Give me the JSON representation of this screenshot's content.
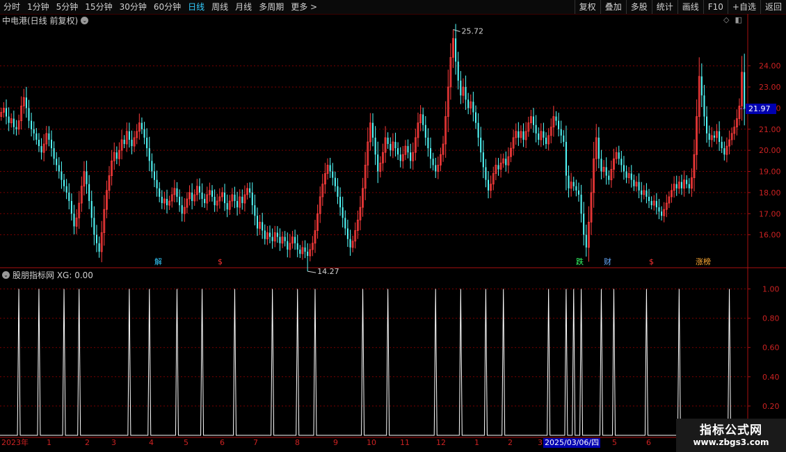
{
  "toolbar": {
    "left": [
      "分时",
      "1分钟",
      "5分钟",
      "15分钟",
      "30分钟",
      "60分钟",
      "日线",
      "周线",
      "月线",
      "多周期",
      "更多 >"
    ],
    "active_index": 6,
    "right": [
      "复权",
      "叠加",
      "多股",
      "统计",
      "画线",
      "F10",
      "+自选",
      "返回"
    ]
  },
  "main_title": "中电港(日线 前复权)",
  "indicator_title": "股朋指标网 XG: 0.00",
  "current_price": "21.97",
  "price_axis": [
    "24.00",
    "23.00",
    "22.00",
    "21.00",
    "20.00",
    "19.00",
    "18.00",
    "17.00",
    "16.00"
  ],
  "ind_axis": [
    "1.00",
    "0.80",
    "0.60",
    "0.40",
    "0.20"
  ],
  "high_label": "25.72",
  "low_label": "14.27",
  "events": [
    "解",
    "$",
    "跌",
    "财",
    "$",
    "涨榜"
  ],
  "dates": {
    "labels": [
      "2023年",
      "1",
      "2",
      "3",
      "4",
      "5",
      "6",
      "7",
      "8",
      "9",
      "10",
      "11",
      "12",
      "1",
      "2",
      "3",
      "5",
      "6"
    ],
    "selected": "2025/03/06/四"
  },
  "watermark": {
    "line1": "指标公式网",
    "line2": "www.zbgs3.com"
  },
  "colors": {
    "up": "#ff3c3c",
    "down": "#54ffff",
    "grid": "#7a0000",
    "signal": "#ffffff"
  },
  "chart_data": {
    "type": "candlestick",
    "price_ylim": [
      15.0,
      25.9
    ],
    "indicator_ylim": [
      0,
      1.05
    ],
    "close": [
      21.8,
      22.0,
      21.6,
      21.3,
      21.5,
      21.1,
      21.0,
      21.4,
      22.1,
      22.5,
      22.0,
      21.4,
      21.0,
      20.8,
      20.5,
      20.2,
      19.9,
      20.3,
      20.8,
      20.5,
      20.1,
      19.6,
      19.3,
      19.0,
      18.6,
      18.3,
      18.0,
      17.6,
      17.0,
      16.4,
      16.8,
      17.5,
      18.3,
      19.0,
      18.4,
      17.6,
      16.8,
      16.0,
      15.6,
      15.2,
      16.1,
      17.2,
      18.1,
      18.8,
      19.5,
      19.9,
      19.6,
      20.0,
      20.5,
      20.3,
      20.9,
      20.5,
      20.2,
      20.6,
      20.9,
      21.3,
      21.0,
      20.6,
      20.1,
      19.5,
      19.0,
      18.6,
      18.2,
      17.8,
      17.5,
      17.7,
      17.4,
      17.6,
      17.9,
      18.2,
      17.8,
      17.4,
      17.0,
      17.3,
      17.7,
      18.0,
      17.6,
      17.9,
      18.3,
      18.0,
      17.7,
      17.5,
      17.9,
      18.1,
      17.8,
      17.4,
      17.6,
      17.8,
      18.0,
      17.5,
      17.2,
      17.6,
      17.9,
      17.6,
      17.3,
      17.8,
      17.5,
      17.9,
      18.2,
      18.0,
      17.4,
      16.9,
      16.3,
      16.6,
      16.2,
      15.8,
      16.1,
      15.9,
      15.7,
      16.1,
      15.9,
      15.6,
      15.9,
      15.7,
      15.3,
      15.6,
      15.9,
      15.6,
      15.3,
      15.1,
      15.4,
      15.2,
      15.0,
      15.3,
      15.6,
      16.2,
      17.0,
      17.8,
      18.4,
      18.9,
      19.3,
      19.0,
      18.7,
      18.3,
      17.8,
      17.3,
      16.8,
      16.3,
      15.8,
      15.4,
      15.7,
      16.2,
      16.7,
      17.3,
      18.2,
      19.3,
      20.4,
      21.3,
      20.6,
      19.8,
      19.0,
      19.4,
      19.9,
      20.6,
      20.3,
      20.0,
      20.4,
      20.1,
      19.8,
      19.5,
      19.8,
      20.2,
      19.9,
      19.5,
      19.9,
      20.6,
      21.3,
      21.7,
      21.2,
      20.6,
      20.1,
      19.6,
      19.3,
      19.0,
      19.3,
      19.8,
      20.3,
      21.6,
      23.0,
      24.4,
      25.3,
      24.2,
      23.3,
      22.6,
      23.0,
      22.4,
      22.0,
      22.3,
      21.8,
      21.3,
      20.6,
      19.9,
      19.2,
      18.6,
      18.1,
      18.4,
      18.9,
      19.3,
      19.1,
      19.4,
      19.6,
      19.3,
      19.7,
      20.1,
      20.6,
      20.9,
      20.6,
      20.9,
      20.5,
      20.9,
      21.3,
      21.6,
      21.2,
      20.8,
      20.5,
      20.9,
      20.6,
      20.3,
      20.7,
      21.1,
      21.6,
      21.4,
      21.0,
      20.7,
      20.4,
      18.8,
      18.2,
      18.5,
      18.3,
      18.1,
      17.9,
      17.0,
      16.0,
      15.4,
      16.6,
      18.0,
      19.6,
      20.6,
      19.6,
      19.0,
      19.2,
      18.8,
      18.6,
      19.1,
      19.6,
      19.9,
      19.6,
      19.3,
      19.0,
      18.7,
      18.9,
      18.6,
      18.3,
      18.5,
      18.1,
      17.9,
      18.1,
      17.8,
      17.6,
      17.4,
      17.6,
      17.3,
      17.1,
      16.9,
      17.2,
      17.5,
      17.8,
      18.1,
      18.4,
      18.2,
      18.5,
      18.2,
      18.6,
      18.4,
      18.2,
      18.7,
      19.8,
      21.6,
      23.5,
      22.6,
      21.6,
      20.8,
      20.5,
      20.7,
      20.6,
      20.9,
      20.4,
      20.1,
      19.8,
      20.2,
      20.5,
      20.8,
      21.1,
      21.5,
      22.1,
      23.7,
      21.97
    ],
    "signal_index": [
      7,
      15,
      25,
      31,
      51,
      59,
      70,
      80,
      93,
      108,
      118,
      125,
      144,
      154,
      173,
      183,
      193,
      200,
      218,
      225,
      228,
      231,
      239,
      244,
      257,
      270,
      290,
      308
    ]
  }
}
